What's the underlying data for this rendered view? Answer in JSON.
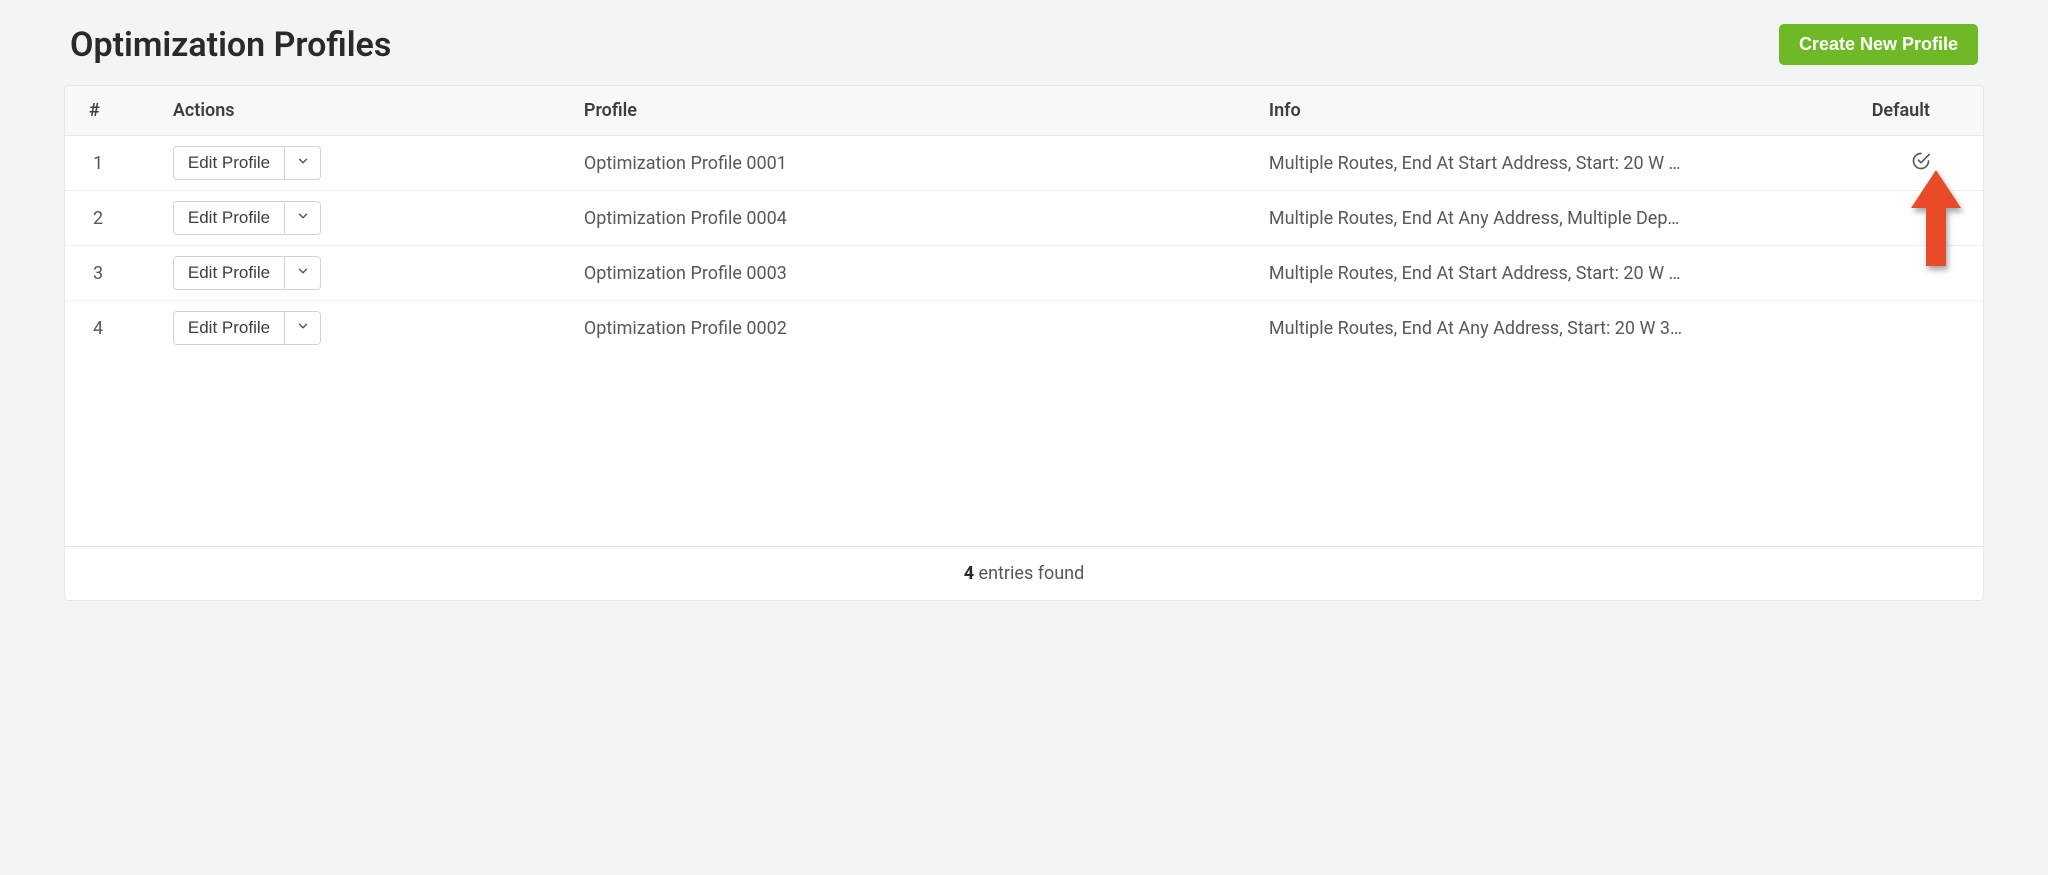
{
  "header": {
    "title": "Optimization Profiles",
    "create_button": "Create New Profile"
  },
  "table": {
    "columns": {
      "num": "#",
      "actions": "Actions",
      "profile": "Profile",
      "info": "Info",
      "default": "Default"
    },
    "edit_label": "Edit Profile",
    "rows": [
      {
        "num": "1",
        "profile": "Optimization Profile 0001",
        "info": "Multiple Routes, End At Start Address, Start: 20 W …",
        "is_default": true
      },
      {
        "num": "2",
        "profile": "Optimization Profile 0004",
        "info": "Multiple Routes, End At Any Address, Multiple Dep…",
        "is_default": false
      },
      {
        "num": "3",
        "profile": "Optimization Profile 0003",
        "info": "Multiple Routes, End At Start Address, Start: 20 W …",
        "is_default": false
      },
      {
        "num": "4",
        "profile": "Optimization Profile 0002",
        "info": "Multiple Routes, End At Any Address, Start: 20 W 3…",
        "is_default": false
      }
    ]
  },
  "footer": {
    "count": "4",
    "label": " entries found"
  },
  "icons": {
    "check": "check-circle-icon",
    "chevron": "chevron-down-icon"
  },
  "colors": {
    "accent_green": "#6fb926",
    "arrow_red": "#e84a2a"
  }
}
